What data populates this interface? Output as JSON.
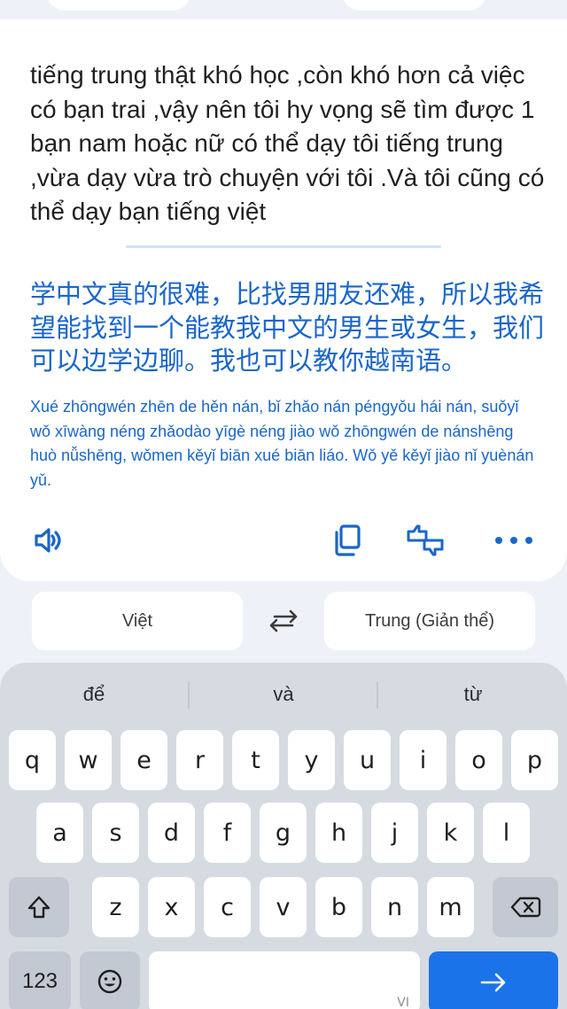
{
  "source": {
    "text": "tiếng trung thật khó học ,còn khó hơn cả việc có bạn trai ,vậy nên tôi hy vọng sẽ tìm được 1 bạn nam hoặc nữ có thể dạy tôi tiếng trung ,vừa dạy vừa trò chuyện với tôi .Và tôi cũng có thể dạy bạn tiếng việt"
  },
  "translation": {
    "text": "学中文真的很难，比找男朋友还难，所以我希望能找到一个能教我中文的男生或女生，我们可以边学边聊。我也可以教你越南语。",
    "romanization": "Xué zhōngwén zhēn de hěn nán, bǐ zhǎo nán péngyǒu hái nán, suǒyǐ wǒ xīwàng néng zhǎodào yīgè néng jiào wǒ zhōngwén de nánshēng huò nǚshēng, wǒmen kěyǐ biān xué biān liáo. Wǒ yě kěyǐ jiào nǐ yuènán yǔ."
  },
  "actions": {
    "icons": [
      "speaker-icon",
      "copy-icon",
      "feedback-icon",
      "more-icon"
    ],
    "accent_color": "#1a66c9"
  },
  "languages": {
    "source_label": "Việt",
    "target_label": "Trung (Giản thể)"
  },
  "keyboard": {
    "suggestions": [
      "để",
      "và",
      "từ"
    ],
    "row1": [
      "q",
      "w",
      "e",
      "r",
      "t",
      "y",
      "u",
      "i",
      "o",
      "p"
    ],
    "row2": [
      "a",
      "s",
      "d",
      "f",
      "g",
      "h",
      "j",
      "k",
      "l"
    ],
    "row3": [
      "z",
      "x",
      "c",
      "v",
      "b",
      "n",
      "m"
    ],
    "numbers_label": "123",
    "space_locale": "VI",
    "enter_color": "#1a73e8"
  }
}
